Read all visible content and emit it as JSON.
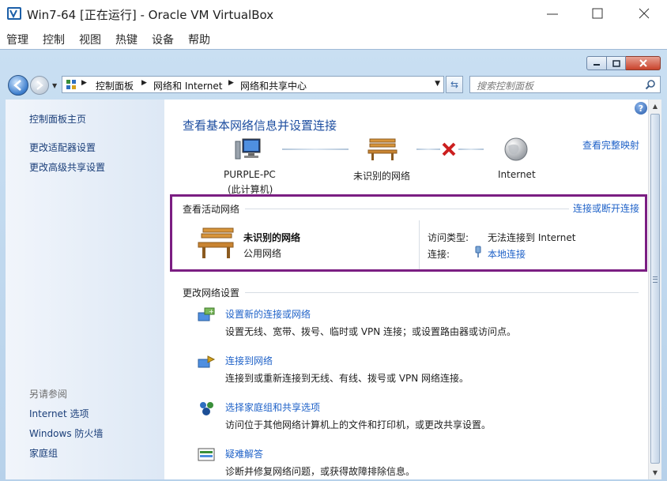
{
  "host": {
    "title": "Win7-64 [正在运行] - Oracle VM VirtualBox",
    "menu": [
      "管理",
      "控制",
      "视图",
      "热键",
      "设备",
      "帮助"
    ]
  },
  "nav": {
    "breadcrumb": [
      "控制面板",
      "网络和 Internet",
      "网络和共享中心"
    ],
    "search_placeholder": "搜索控制面板"
  },
  "left_panel": {
    "links": [
      "控制面板主页",
      "更改适配器设置",
      "更改高级共享设置"
    ],
    "see_also_heading": "另请参阅",
    "see_also": [
      "Internet 选项",
      "Windows 防火墙",
      "家庭组"
    ]
  },
  "main": {
    "title": "查看基本网络信息并设置连接",
    "full_map_link": "查看完整映射",
    "map": {
      "computer_name": "PURPLE-PC",
      "computer_sub": "(此计算机)",
      "network": "未识别的网络",
      "internet": "Internet",
      "status_to_internet": "disconnected"
    },
    "active": {
      "heading": "查看活动网络",
      "connect_link": "连接或断开连接",
      "network_name": "未识别的网络",
      "network_type": "公用网络",
      "access_type_label": "访问类型:",
      "access_type_value": "无法连接到 Internet",
      "connection_label": "连接:",
      "connection_value": "本地连接"
    },
    "change_heading": "更改网络设置",
    "tasks": [
      {
        "title": "设置新的连接或网络",
        "desc": "设置无线、宽带、拨号、临时或 VPN 连接；或设置路由器或访问点。"
      },
      {
        "title": "连接到网络",
        "desc": "连接到或重新连接到无线、有线、拨号或 VPN 网络连接。"
      },
      {
        "title": "选择家庭组和共享选项",
        "desc": "访问位于其他网络计算机上的文件和打印机，或更改共享设置。"
      },
      {
        "title": "疑难解答",
        "desc": "诊断并修复网络问题，或获得故障排除信息。"
      }
    ]
  },
  "colors": {
    "link": "#1f62c8",
    "title": "#1e4ea0",
    "highlight_border": "#7b1e82",
    "error_x": "#cc1f1f"
  },
  "icons": {
    "host_app": "virtualbox-icon",
    "computer": "computer-icon",
    "network": "bench-network-icon",
    "internet": "globe-icon",
    "disconnect": "red-x-icon",
    "connection": "ethernet-plug-icon"
  }
}
